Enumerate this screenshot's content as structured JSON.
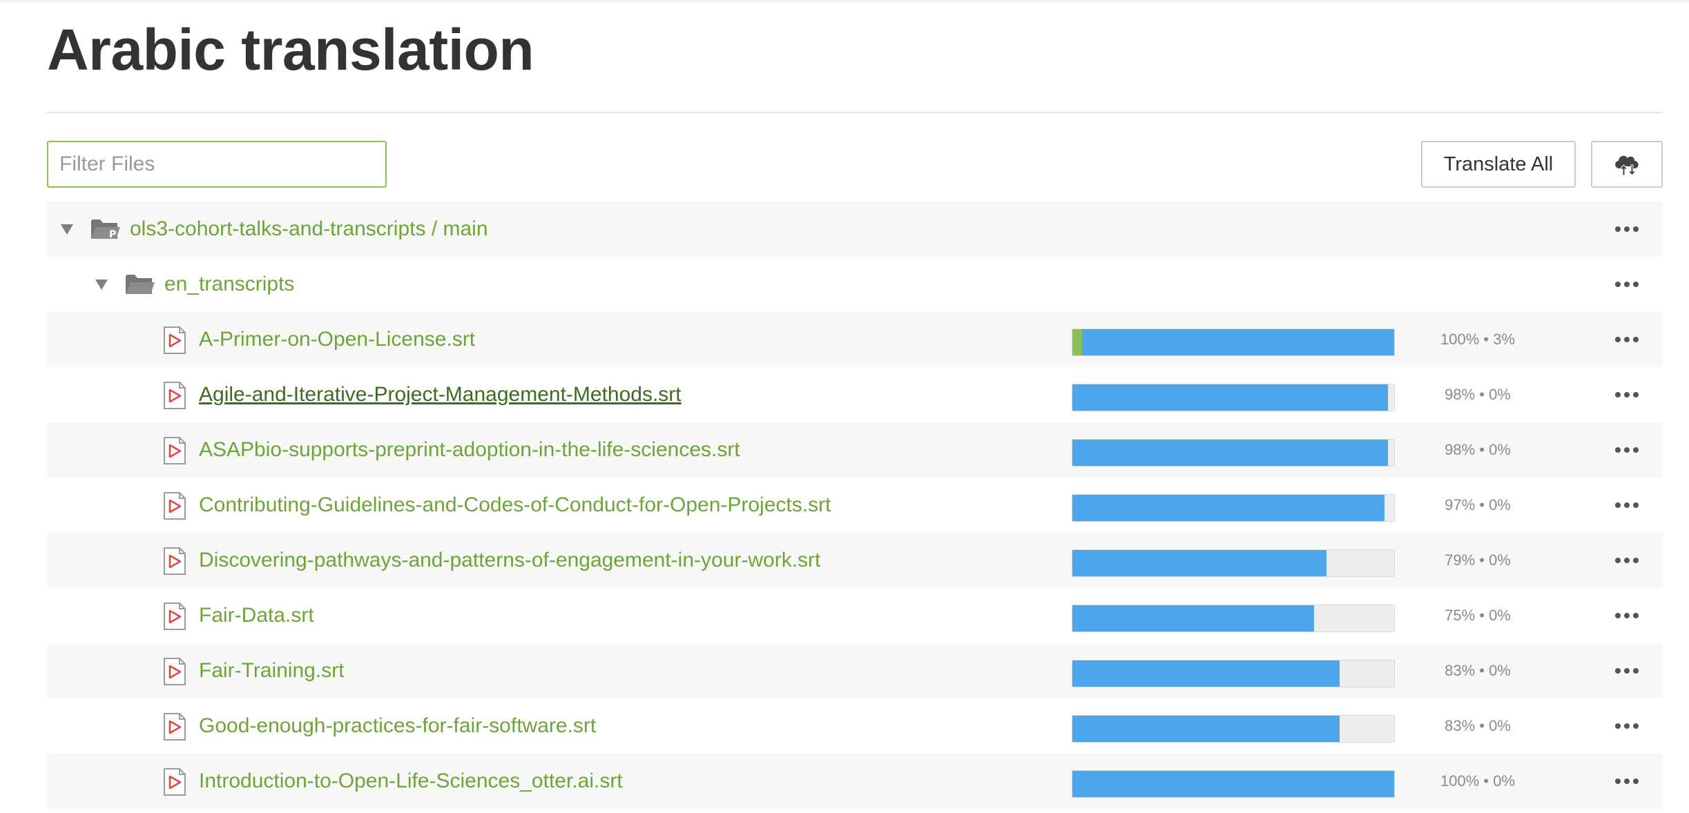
{
  "page": {
    "title": "Arabic translation"
  },
  "filter": {
    "placeholder": "Filter Files",
    "value": ""
  },
  "toolbar": {
    "translate_all_label": "Translate All",
    "sync_icon": "cloud-upload-download-icon"
  },
  "colors": {
    "link_green": "#6da43a",
    "translated_blue": "#4da6ed",
    "approved_green": "#8cc152",
    "bar_background": "#ededed"
  },
  "tree": {
    "project": {
      "name": "ols3-cohort-talks-and-transcripts / main",
      "icon": "project-folder-icon",
      "expanded": true
    },
    "folder": {
      "name": "en_transcripts",
      "icon": "folder-open-icon",
      "expanded": true
    },
    "files": [
      {
        "name": "A-Primer-on-Open-License.srt",
        "translated_percent": 100,
        "approved_percent": 3,
        "stats": "100% • 3%"
      },
      {
        "name": "Agile-and-Iterative-Project-Management-Methods.srt",
        "translated_percent": 98,
        "approved_percent": 0,
        "stats": "98% • 0%"
      },
      {
        "name": "ASAPbio-supports-preprint-adoption-in-the-life-sciences.srt",
        "translated_percent": 98,
        "approved_percent": 0,
        "stats": "98% • 0%"
      },
      {
        "name": "Contributing-Guidelines-and-Codes-of-Conduct-for-Open-Projects.srt",
        "translated_percent": 97,
        "approved_percent": 0,
        "stats": "97% • 0%"
      },
      {
        "name": "Discovering-pathways-and-patterns-of-engagement-in-your-work.srt",
        "translated_percent": 79,
        "approved_percent": 0,
        "stats": "79% • 0%"
      },
      {
        "name": "Fair-Data.srt",
        "translated_percent": 75,
        "approved_percent": 0,
        "stats": "75% • 0%"
      },
      {
        "name": "Fair-Training.srt",
        "translated_percent": 83,
        "approved_percent": 0,
        "stats": "83% • 0%"
      },
      {
        "name": "Good-enough-practices-for-fair-software.srt",
        "translated_percent": 83,
        "approved_percent": 0,
        "stats": "83% • 0%"
      },
      {
        "name": "Introduction-to-Open-Life-Sciences_otter.ai.srt",
        "translated_percent": 100,
        "approved_percent": 0,
        "stats": "100% • 0%"
      }
    ]
  }
}
